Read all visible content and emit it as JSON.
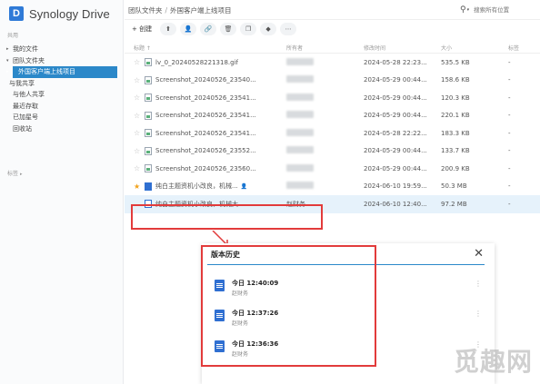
{
  "app": {
    "logo_letter": "D",
    "name": "Synology Drive"
  },
  "sidebar": {
    "section_label": "共用",
    "items": [
      {
        "label": "我的文件",
        "caret": "▸"
      },
      {
        "label": "团队文件夹",
        "caret": "▾"
      },
      {
        "label": "外国客户端上线项目",
        "caret": "▸"
      },
      {
        "label": "与我共享"
      },
      {
        "label": "与他人共享"
      },
      {
        "label": "最近存取"
      },
      {
        "label": "已加星号"
      },
      {
        "label": "回收站"
      }
    ],
    "tags_label": "标签"
  },
  "header": {
    "breadcrumb": [
      "团队文件夹",
      "外国客户端上线项目"
    ],
    "search_placeholder": "搜索所有位置"
  },
  "toolbar": {
    "create_label": "+ 创建"
  },
  "table": {
    "columns": {
      "name": "标题 ↑",
      "owner": "所有者",
      "modified": "修改时间",
      "size": "大小",
      "tags": "标签"
    },
    "rows": [
      {
        "name": "lv_0_20240528221318.gif",
        "modified": "2024-05-28 22:23...",
        "size": "535.5 KB",
        "tags": "-",
        "icon": "img",
        "starred": false
      },
      {
        "name": "Screenshot_20240526_23540...",
        "modified": "2024-05-29 00:44...",
        "size": "158.6 KB",
        "tags": "-",
        "icon": "img",
        "starred": false
      },
      {
        "name": "Screenshot_20240526_23541...",
        "modified": "2024-05-29 00:44...",
        "size": "120.3 KB",
        "tags": "-",
        "icon": "img",
        "starred": false
      },
      {
        "name": "Screenshot_20240526_23541...",
        "modified": "2024-05-29 00:44...",
        "size": "220.1 KB",
        "tags": "-",
        "icon": "img",
        "starred": false
      },
      {
        "name": "Screenshot_20240526_23541...",
        "modified": "2024-05-28 22:22...",
        "size": "183.3 KB",
        "tags": "-",
        "icon": "img",
        "starred": false
      },
      {
        "name": "Screenshot_20240526_23552...",
        "modified": "2024-05-29 00:44...",
        "size": "133.7 KB",
        "tags": "-",
        "icon": "img",
        "starred": false
      },
      {
        "name": "Screenshot_20240526_23560...",
        "modified": "2024-05-29 00:44...",
        "size": "200.9 KB",
        "tags": "-",
        "icon": "img",
        "starred": false
      },
      {
        "name": "纯白主题资机小改良，机械...",
        "modified": "2024-06-10 19:59...",
        "size": "50.3 MB",
        "tags": "-",
        "icon": "doc",
        "starred": true,
        "shared": true
      },
      {
        "name": "纯白主题资机小改良，机械大...",
        "owner": "赵财务",
        "modified": "2024-06-10 12:40...",
        "size": "97.2 MB",
        "tags": "-",
        "icon": "doc2",
        "starred": false,
        "selected": true
      }
    ]
  },
  "panel": {
    "title": "版本历史",
    "close": "✕",
    "versions": [
      {
        "time": "今日 12:40:09",
        "author": "赵财务"
      },
      {
        "time": "今日 12:37:26",
        "author": "赵财务"
      },
      {
        "time": "今日 12:36:36",
        "author": "赵财务"
      }
    ]
  },
  "watermark": "觅趣网"
}
